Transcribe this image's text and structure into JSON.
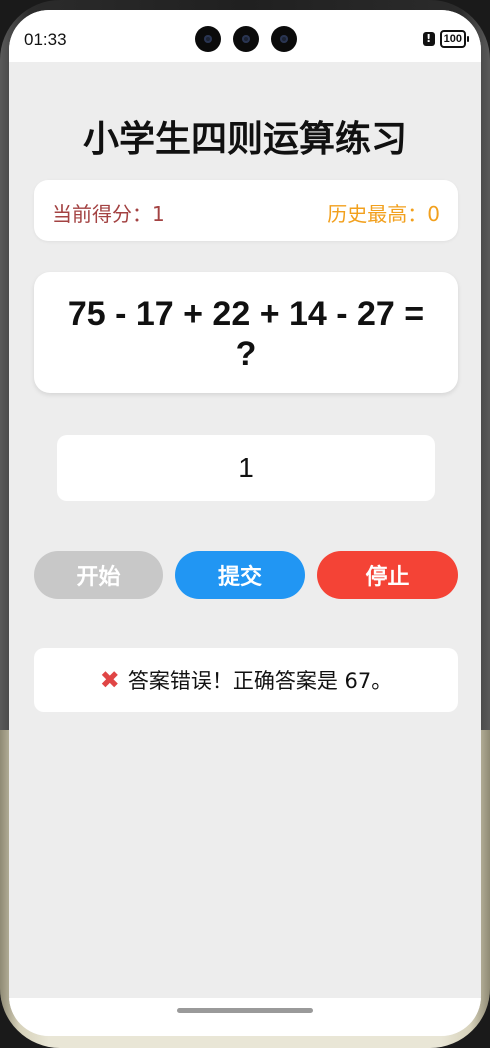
{
  "status_bar": {
    "time": "01:33",
    "battery": "100",
    "alert_glyph": "!"
  },
  "page": {
    "title": "小学生四则运算练习"
  },
  "score": {
    "current_label": "当前得分：1",
    "best_label": "历史最高：0"
  },
  "question": {
    "expression": "75 - 17 + 22 + 14 - 27 = ?"
  },
  "answer_input": {
    "value": "1"
  },
  "buttons": {
    "start": "开始",
    "submit": "提交",
    "stop": "停止"
  },
  "result": {
    "icon": "cross-mark-icon",
    "icon_glyph": "✖",
    "message": "答案错误！正确答案是 67。"
  },
  "colors": {
    "score_current": "#a34242",
    "score_best": "#f2a01d",
    "start_button_disabled": "#c8c8c8",
    "submit_button": "#2196f3",
    "stop_button": "#f44336",
    "error_icon": "#e04545"
  }
}
